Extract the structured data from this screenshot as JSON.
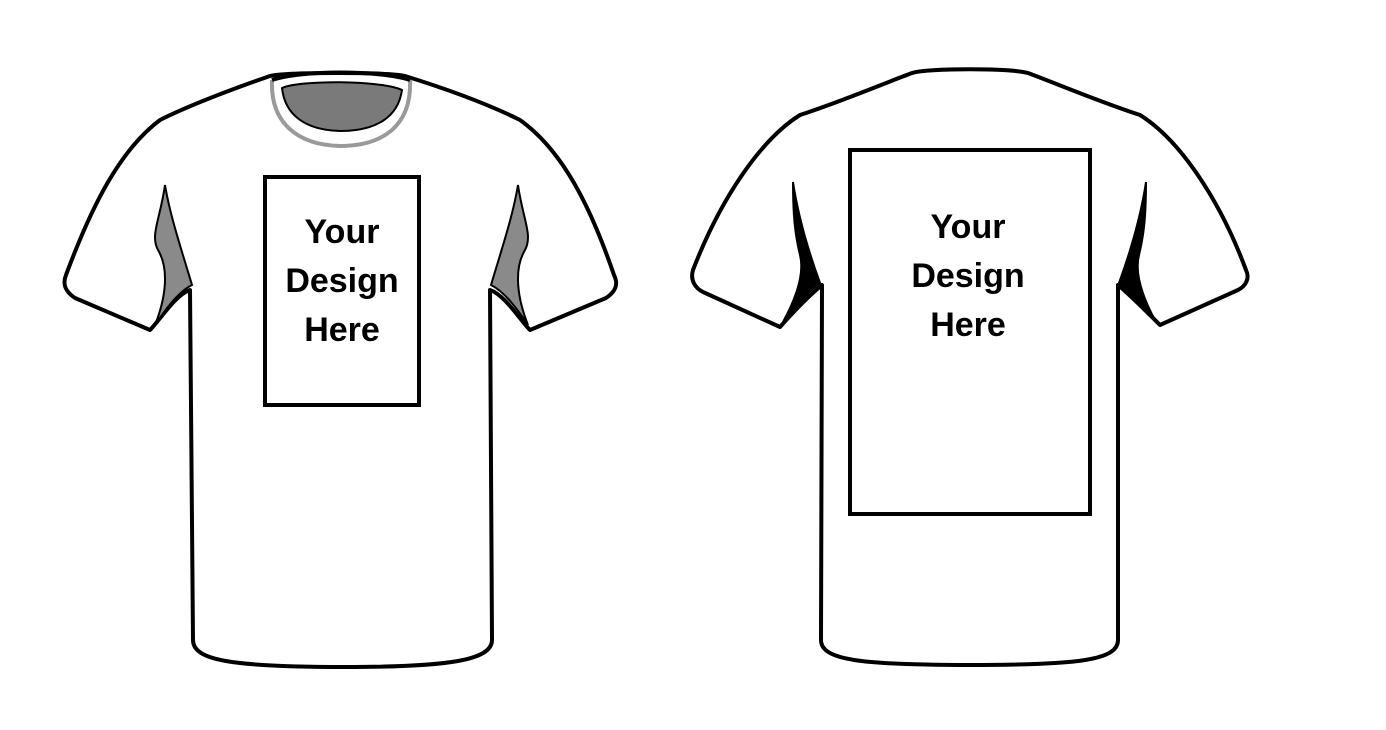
{
  "front": {
    "line1": "Your",
    "line2": "Design",
    "line3": "Here"
  },
  "back": {
    "line1": "Your",
    "line2": "Design",
    "line3": "Here"
  },
  "colors": {
    "background": "#ffffff",
    "outline": "#000000",
    "shadow": "#8a8a8a",
    "collar_inner": "#7a7a7a"
  },
  "icons": {
    "front_view": "tshirt-front-icon",
    "back_view": "tshirt-back-icon"
  }
}
